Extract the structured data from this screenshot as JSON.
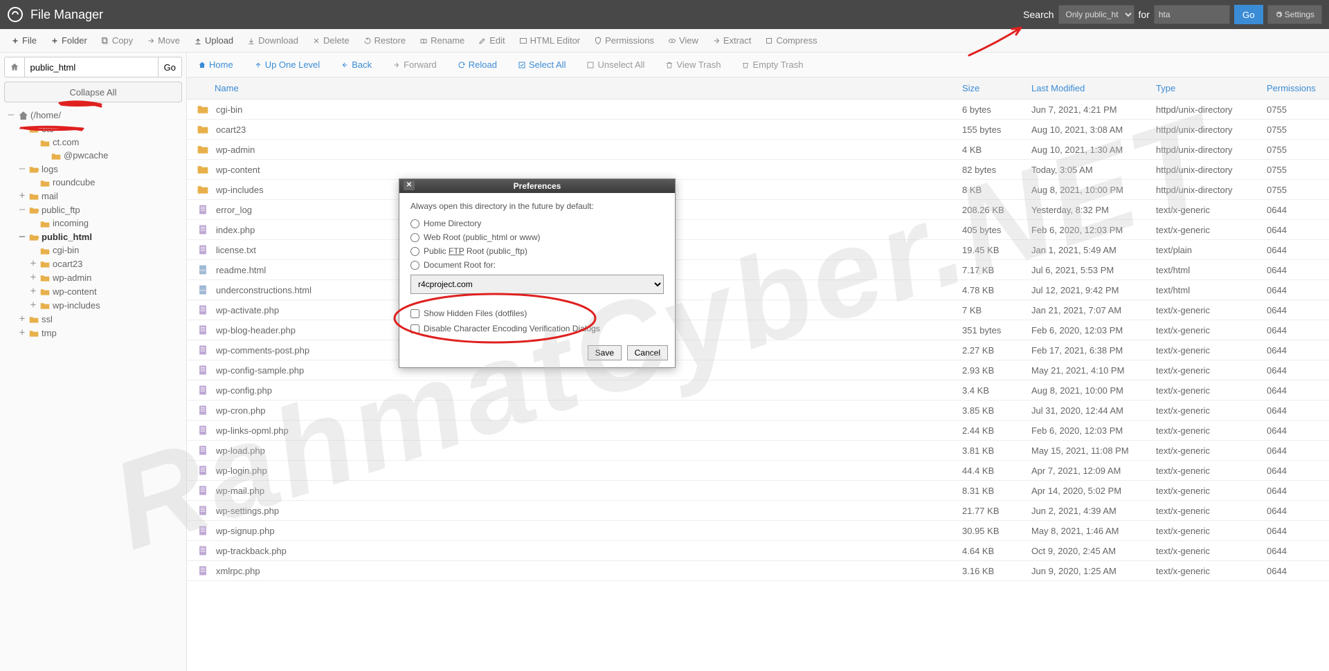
{
  "header": {
    "title": "File Manager",
    "search_label": "Search",
    "scope_options": [
      "Only public_html"
    ],
    "scope_value": "Only public_html",
    "for_label": "for",
    "search_value": "hta",
    "go": "Go",
    "settings": "Settings"
  },
  "toolbar": [
    {
      "icon": "plus",
      "label": "File",
      "enabled": true
    },
    {
      "icon": "plus",
      "label": "Folder",
      "enabled": true
    },
    {
      "icon": "copy",
      "label": "Copy",
      "enabled": false
    },
    {
      "icon": "move",
      "label": "Move",
      "enabled": false
    },
    {
      "icon": "upload",
      "label": "Upload",
      "enabled": true
    },
    {
      "icon": "download",
      "label": "Download",
      "enabled": false
    },
    {
      "icon": "delete",
      "label": "Delete",
      "enabled": false
    },
    {
      "icon": "restore",
      "label": "Restore",
      "enabled": false
    },
    {
      "icon": "rename",
      "label": "Rename",
      "enabled": false
    },
    {
      "icon": "edit",
      "label": "Edit",
      "enabled": false
    },
    {
      "icon": "html",
      "label": "HTML Editor",
      "enabled": false
    },
    {
      "icon": "perm",
      "label": "Permissions",
      "enabled": false
    },
    {
      "icon": "view",
      "label": "View",
      "enabled": false
    },
    {
      "icon": "extract",
      "label": "Extract",
      "enabled": false
    },
    {
      "icon": "compress",
      "label": "Compress",
      "enabled": false
    }
  ],
  "sidebar": {
    "path_value": "public_html",
    "go": "Go",
    "collapse": "Collapse All",
    "tree": [
      {
        "depth": 0,
        "toggle": "–",
        "icon": "home",
        "label": "(/home/",
        "redacted": true
      },
      {
        "depth": 1,
        "toggle": "–",
        "icon": "folder-open",
        "label": "etc"
      },
      {
        "depth": 2,
        "toggle": "",
        "icon": "folder",
        "label": "ct.com",
        "redacted": true
      },
      {
        "depth": 3,
        "toggle": "",
        "icon": "folder",
        "label": "@pwcache"
      },
      {
        "depth": 1,
        "toggle": "–",
        "icon": "folder-open",
        "label": "logs"
      },
      {
        "depth": 2,
        "toggle": "",
        "icon": "folder",
        "label": "roundcube"
      },
      {
        "depth": 1,
        "toggle": "+",
        "icon": "folder",
        "label": "mail"
      },
      {
        "depth": 1,
        "toggle": "–",
        "icon": "folder-open",
        "label": "public_ftp"
      },
      {
        "depth": 2,
        "toggle": "",
        "icon": "folder",
        "label": "incoming"
      },
      {
        "depth": 1,
        "toggle": "–",
        "icon": "folder-open",
        "label": "public_html",
        "selected": true
      },
      {
        "depth": 2,
        "toggle": "",
        "icon": "folder",
        "label": "cgi-bin"
      },
      {
        "depth": 2,
        "toggle": "+",
        "icon": "folder",
        "label": "ocart23"
      },
      {
        "depth": 2,
        "toggle": "+",
        "icon": "folder",
        "label": "wp-admin"
      },
      {
        "depth": 2,
        "toggle": "+",
        "icon": "folder",
        "label": "wp-content"
      },
      {
        "depth": 2,
        "toggle": "+",
        "icon": "folder",
        "label": "wp-includes"
      },
      {
        "depth": 1,
        "toggle": "+",
        "icon": "folder",
        "label": "ssl"
      },
      {
        "depth": 1,
        "toggle": "+",
        "icon": "folder",
        "label": "tmp"
      }
    ]
  },
  "nav": [
    {
      "icon": "home",
      "label": "Home",
      "muted": false
    },
    {
      "icon": "up",
      "label": "Up One Level",
      "muted": false
    },
    {
      "icon": "back",
      "label": "Back",
      "muted": false
    },
    {
      "icon": "forward",
      "label": "Forward",
      "muted": true
    },
    {
      "icon": "reload",
      "label": "Reload",
      "muted": false
    },
    {
      "icon": "selectall",
      "label": "Select All",
      "muted": false
    },
    {
      "icon": "unselect",
      "label": "Unselect All",
      "muted": true
    },
    {
      "icon": "trash",
      "label": "View Trash",
      "muted": true
    },
    {
      "icon": "empty",
      "label": "Empty Trash",
      "muted": true
    }
  ],
  "cols": {
    "name": "Name",
    "size": "Size",
    "mod": "Last Modified",
    "type": "Type",
    "perm": "Permissions"
  },
  "files": [
    {
      "i": "folder",
      "n": "cgi-bin",
      "s": "6 bytes",
      "m": "Jun 7, 2021, 4:21 PM",
      "t": "httpd/unix-directory",
      "p": "0755"
    },
    {
      "i": "folder",
      "n": "ocart23",
      "s": "155 bytes",
      "m": "Aug 10, 2021, 3:08 AM",
      "t": "httpd/unix-directory",
      "p": "0755"
    },
    {
      "i": "folder",
      "n": "wp-admin",
      "s": "4 KB",
      "m": "Aug 10, 2021, 1:30 AM",
      "t": "httpd/unix-directory",
      "p": "0755"
    },
    {
      "i": "folder",
      "n": "wp-content",
      "s": "82 bytes",
      "m": "Today, 3:05 AM",
      "t": "httpd/unix-directory",
      "p": "0755"
    },
    {
      "i": "folder",
      "n": "wp-includes",
      "s": "8 KB",
      "m": "Aug 8, 2021, 10:00 PM",
      "t": "httpd/unix-directory",
      "p": "0755"
    },
    {
      "i": "file",
      "n": "error_log",
      "s": "208.26 KB",
      "m": "Yesterday, 8:32 PM",
      "t": "text/x-generic",
      "p": "0644"
    },
    {
      "i": "file",
      "n": "index.php",
      "s": "405 bytes",
      "m": "Feb 6, 2020, 12:03 PM",
      "t": "text/x-generic",
      "p": "0644"
    },
    {
      "i": "file",
      "n": "license.txt",
      "s": "19.45 KB",
      "m": "Jan 1, 2021, 5:49 AM",
      "t": "text/plain",
      "p": "0644"
    },
    {
      "i": "html",
      "n": "readme.html",
      "s": "7.17 KB",
      "m": "Jul 6, 2021, 5:53 PM",
      "t": "text/html",
      "p": "0644"
    },
    {
      "i": "html",
      "n": "underconstructions.html",
      "s": "4.78 KB",
      "m": "Jul 12, 2021, 9:42 PM",
      "t": "text/html",
      "p": "0644"
    },
    {
      "i": "file",
      "n": "wp-activate.php",
      "s": "7 KB",
      "m": "Jan 21, 2021, 7:07 AM",
      "t": "text/x-generic",
      "p": "0644"
    },
    {
      "i": "file",
      "n": "wp-blog-header.php",
      "s": "351 bytes",
      "m": "Feb 6, 2020, 12:03 PM",
      "t": "text/x-generic",
      "p": "0644"
    },
    {
      "i": "file",
      "n": "wp-comments-post.php",
      "s": "2.27 KB",
      "m": "Feb 17, 2021, 6:38 PM",
      "t": "text/x-generic",
      "p": "0644"
    },
    {
      "i": "file",
      "n": "wp-config-sample.php",
      "s": "2.93 KB",
      "m": "May 21, 2021, 4:10 PM",
      "t": "text/x-generic",
      "p": "0644"
    },
    {
      "i": "file",
      "n": "wp-config.php",
      "s": "3.4 KB",
      "m": "Aug 8, 2021, 10:00 PM",
      "t": "text/x-generic",
      "p": "0644"
    },
    {
      "i": "file",
      "n": "wp-cron.php",
      "s": "3.85 KB",
      "m": "Jul 31, 2020, 12:44 AM",
      "t": "text/x-generic",
      "p": "0644"
    },
    {
      "i": "file",
      "n": "wp-links-opml.php",
      "s": "2.44 KB",
      "m": "Feb 6, 2020, 12:03 PM",
      "t": "text/x-generic",
      "p": "0644"
    },
    {
      "i": "file",
      "n": "wp-load.php",
      "s": "3.81 KB",
      "m": "May 15, 2021, 11:08 PM",
      "t": "text/x-generic",
      "p": "0644"
    },
    {
      "i": "file",
      "n": "wp-login.php",
      "s": "44.4 KB",
      "m": "Apr 7, 2021, 12:09 AM",
      "t": "text/x-generic",
      "p": "0644"
    },
    {
      "i": "file",
      "n": "wp-mail.php",
      "s": "8.31 KB",
      "m": "Apr 14, 2020, 5:02 PM",
      "t": "text/x-generic",
      "p": "0644"
    },
    {
      "i": "file",
      "n": "wp-settings.php",
      "s": "21.77 KB",
      "m": "Jun 2, 2021, 4:39 AM",
      "t": "text/x-generic",
      "p": "0644"
    },
    {
      "i": "file",
      "n": "wp-signup.php",
      "s": "30.95 KB",
      "m": "May 8, 2021, 1:46 AM",
      "t": "text/x-generic",
      "p": "0644"
    },
    {
      "i": "file",
      "n": "wp-trackback.php",
      "s": "4.64 KB",
      "m": "Oct 9, 2020, 2:45 AM",
      "t": "text/x-generic",
      "p": "0644"
    },
    {
      "i": "file",
      "n": "xmlrpc.php",
      "s": "3.16 KB",
      "m": "Jun 9, 2020, 1:25 AM",
      "t": "text/x-generic",
      "p": "0644"
    }
  ],
  "modal": {
    "title": "Preferences",
    "intro": "Always open this directory in the future by default:",
    "r1": "Home Directory",
    "r2": "Web Root (public_html or www)",
    "r3_a": "Public ",
    "r3_u": "FTP",
    "r3_b": " Root (public_ftp)",
    "r4": "Document Root for:",
    "domain": "r4cproject.com",
    "chk1": "Show Hidden Files (dotfiles)",
    "chk2": "Disable Character Encoding Verification Dialogs",
    "save": "Save",
    "cancel": "Cancel"
  },
  "watermark": "RahmatCyber.NET"
}
